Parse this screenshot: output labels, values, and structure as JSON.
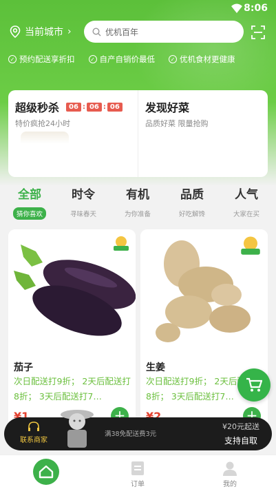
{
  "status": {
    "time": "8:06"
  },
  "header": {
    "city_label": "当前城市",
    "city_chevron": "›",
    "search_placeholder": "优机百年"
  },
  "features": [
    {
      "label": "预约配送享折扣"
    },
    {
      "label": "自产自销价最低"
    },
    {
      "label": "优机食材更健康"
    }
  ],
  "promo": {
    "flash": {
      "title": "超级秒杀",
      "countdown": [
        "06",
        "06",
        "06"
      ],
      "subtitle": "特价疯抢24小时"
    },
    "discover": {
      "title": "发现好菜",
      "subtitle": "品质好菜 限量抢购"
    }
  },
  "categories": [
    {
      "label": "全部",
      "sub": "猜你喜欢"
    },
    {
      "label": "时令",
      "sub": "寻味春天"
    },
    {
      "label": "有机",
      "sub": "为你准备"
    },
    {
      "label": "品质",
      "sub": "好吃解馋"
    },
    {
      "label": "人气",
      "sub": "大家在买"
    }
  ],
  "products": [
    {
      "name": "茄子",
      "promo": "次日配送打9折； 2天后配送打8折； 3天后配送打7…",
      "price": "¥1"
    },
    {
      "name": "生姜",
      "promo": "次日配送打9折； 2天后配送打8折； 3天后配送打7…",
      "price": "¥2"
    }
  ],
  "cartbar": {
    "contact_label": "联系商家",
    "hint": "满38免配送费3元",
    "fee_line1": "¥20元起送",
    "fee_line2": "支持自取"
  },
  "tabbar": {
    "tabs": [
      {
        "label": ""
      },
      {
        "label": "订单"
      },
      {
        "label": "我的"
      }
    ]
  },
  "colors": {
    "brand_green": "#3db14a",
    "hero_green": "#5cc03a",
    "promo_text_green": "#6abf3c",
    "price_red": "#e3412f",
    "countdown_red": "#e75b4f"
  }
}
